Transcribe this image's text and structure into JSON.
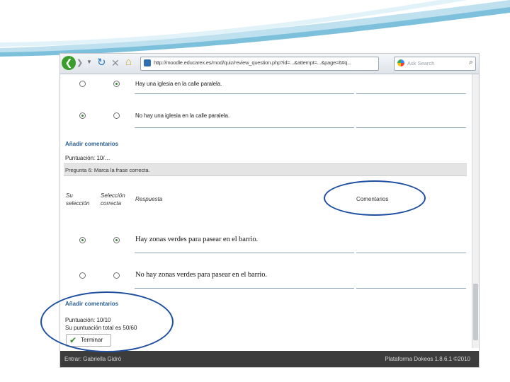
{
  "browser": {
    "url": "http://moodle.educarex.es/mod/quiz/review_question.php?id=...&attempt=...&page=6#q...",
    "search_placeholder": "Ask Search"
  },
  "question_prev": {
    "answers": [
      {
        "text": "Hay una iglesia en la calle paralela.",
        "your_selection": false,
        "correct": true
      },
      {
        "text": "No hay una iglesia en la calle paralela.",
        "your_selection": true,
        "correct": false
      }
    ],
    "add_comments": "Añadir comentarios",
    "score": "Puntuación: 10/…"
  },
  "question": {
    "bar_label": "Pregunta 6: Marca la frase correcta.",
    "col_your_selection": "Su selección",
    "col_correct_selection": "Selección correcta",
    "col_answer": "Respuesta",
    "col_comments": "Comentarios",
    "answers": [
      {
        "text": "Hay zonas verdes para pasear en el barrio.",
        "your_selection": true,
        "correct": true
      },
      {
        "text": "No hay zonas verdes para pasear en el barrio.",
        "your_selection": false,
        "correct": false
      }
    ],
    "add_comments": "Añadir comentarios",
    "score": "Puntuación: 10/10",
    "subtotal": "Su puntuación total es 50/60",
    "finish_label": "Terminar"
  },
  "footer": {
    "left": "Entrar: Gabriella Gidró",
    "right": "Plataforma Dokeos 1.8.6.1 ©2010"
  },
  "colors": {
    "annotation": "#1d4ea0",
    "link": "#2a5f95",
    "footer_bg": "#3c3c3c"
  }
}
